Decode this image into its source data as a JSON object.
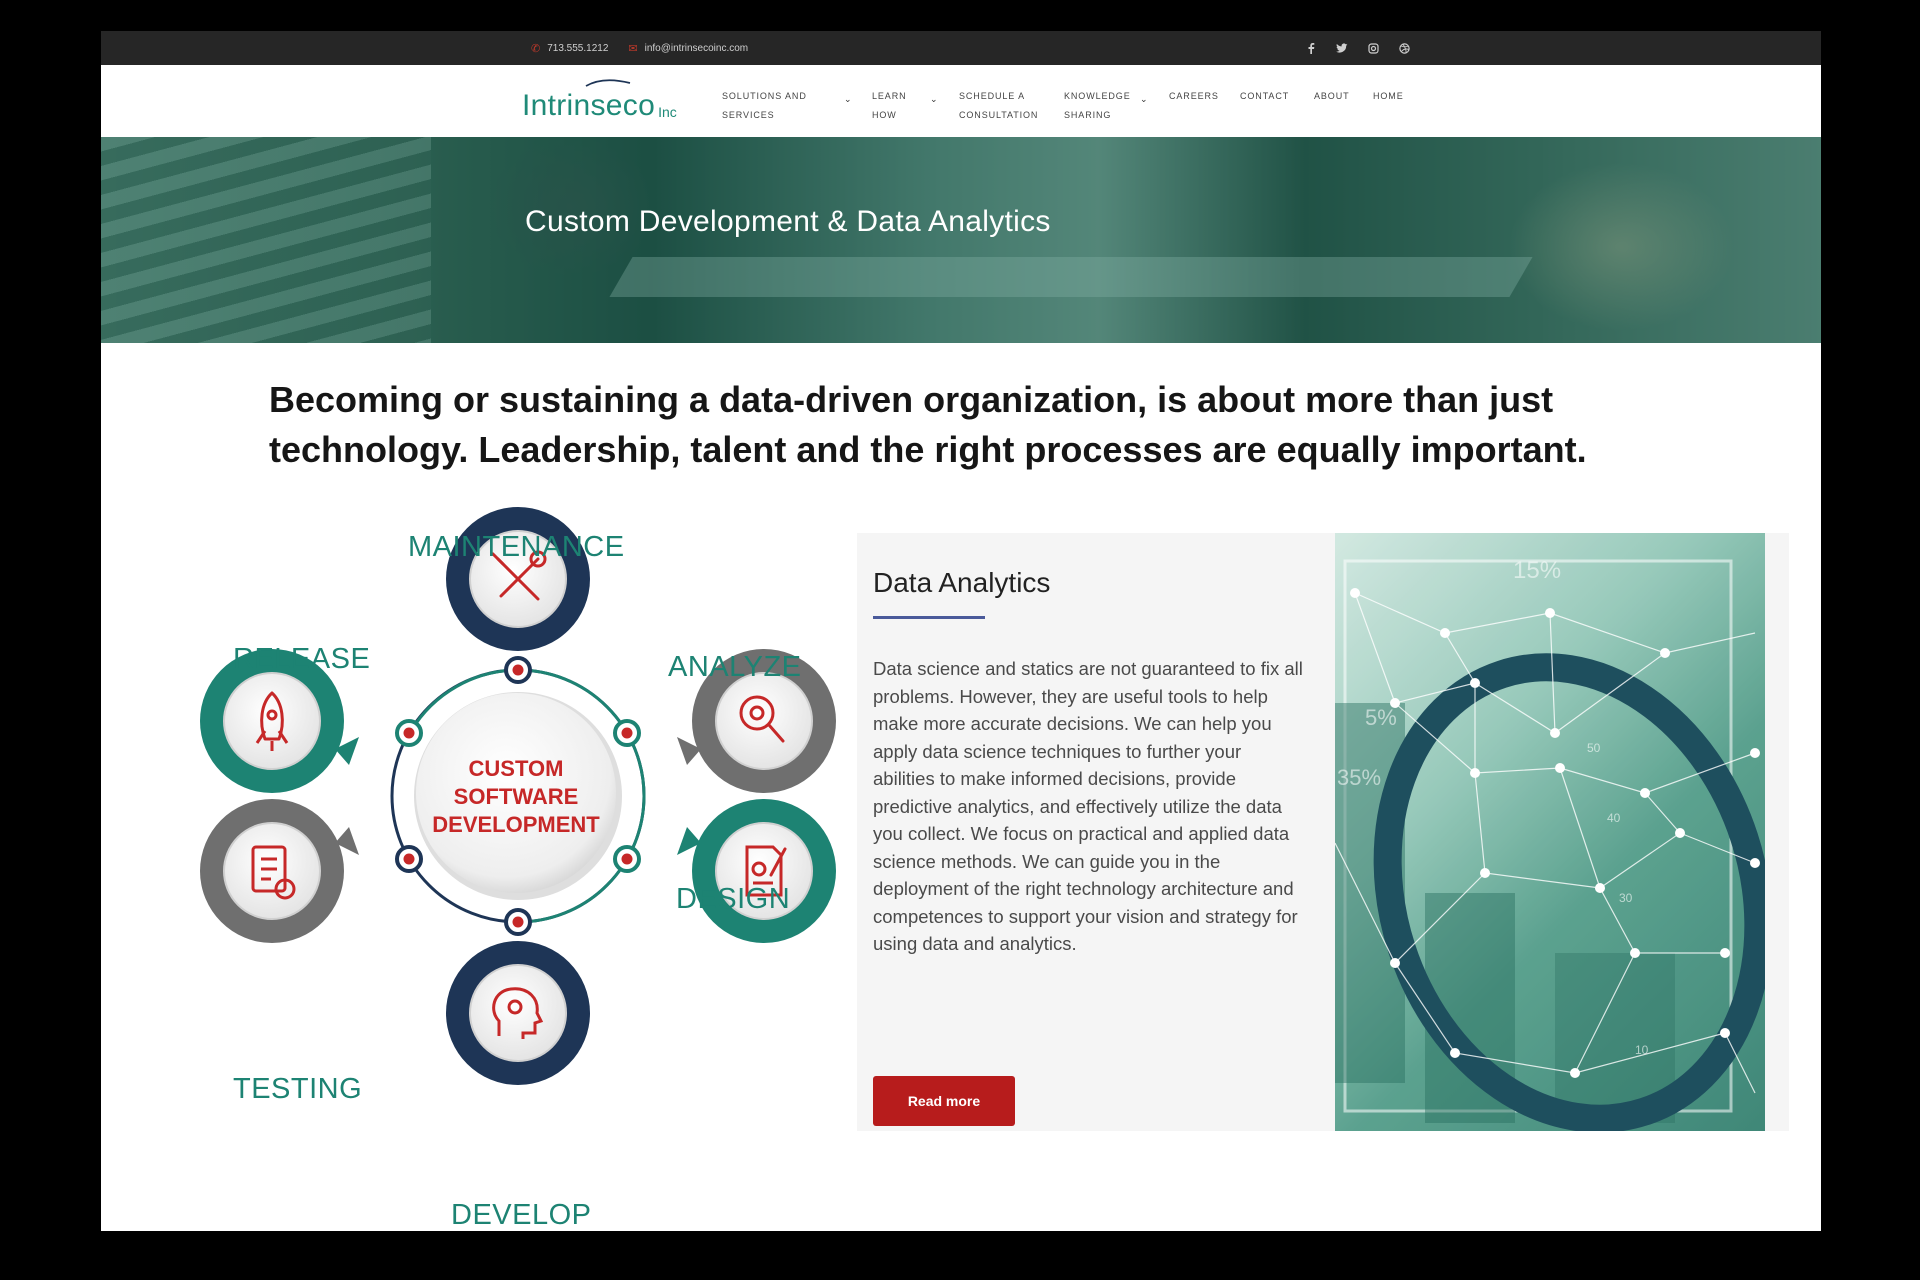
{
  "topbar": {
    "phone": "713.555.1212",
    "email": "info@intrinsecoinc.com",
    "social": [
      "facebook-icon",
      "twitter-icon",
      "instagram-icon",
      "dribbble-icon"
    ]
  },
  "brand": {
    "name": "Intrinseco",
    "suffix": "Inc",
    "color": "#1f8a78"
  },
  "nav": {
    "solutions": {
      "line1": "SOLUTIONS AND",
      "line2": "SERVICES"
    },
    "learn": {
      "line1": "LEARN",
      "line2": "HOW"
    },
    "schedule": {
      "line1": "SCHEDULE A",
      "line2": "CONSULTATION"
    },
    "knowledge": {
      "line1": "KNOWLEDGE",
      "line2": "SHARING"
    },
    "careers": "CAREERS",
    "contact": "CONTACT",
    "about": "ABOUT",
    "home": "HOME"
  },
  "hero": {
    "title": "Custom Development & Data Analytics"
  },
  "headline": {
    "line1": "Becoming or sustaining a data-driven organization, is about more than just",
    "line2": "technology.  Leadership, talent and the right processes are equally important."
  },
  "diagram": {
    "center": {
      "line1": "CUSTOM",
      "line2": "SOFTWARE",
      "line3": "DEVELOPMENT"
    },
    "labels": {
      "maintenance": "MAINTENANCE",
      "analyze": "ANALYZE",
      "design": "DESIGN",
      "develop": "DEVELOP",
      "testing": "TESTING",
      "release": "RELEASE"
    },
    "colors": {
      "teal": "#1d8373",
      "navy": "#1e3556",
      "gray": "#6f6f6f",
      "red": "#c62828"
    }
  },
  "analytics": {
    "title": "Data Analytics",
    "body": "Data science and statics are not guaranteed to fix all problems. However, they are useful tools to help make more accurate decisions. We can help you apply data science techniques to further your abilities to make informed decisions, provide predictive analytics, and effectively utilize the data you collect. We focus on practical and applied data science methods. We can guide you in the deployment of the right technology architecture and competences to support your vision and strategy for using data and analytics.",
    "button": "Read more",
    "image_labels": {
      "a": "15%",
      "b": "5%",
      "c": "35%",
      "d": "50",
      "e": "40",
      "f": "30",
      "g": "10"
    }
  }
}
